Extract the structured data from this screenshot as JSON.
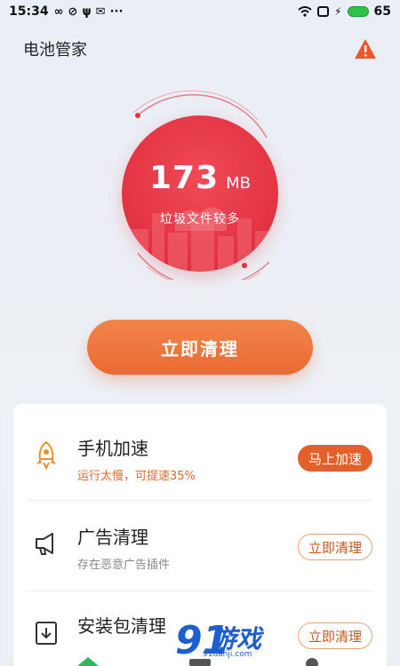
{
  "status_bar": {
    "time": "15:34",
    "left_icons": [
      "infinity-icon",
      "circle-check-icon",
      "usb-icon",
      "mail-icon",
      "more-dots-icon"
    ],
    "battery": "65",
    "right_icons": [
      "wifi-icon",
      "screen-icon",
      "charging-icon",
      "battery-icon"
    ]
  },
  "header": {
    "title": "电池管家",
    "warning_icon": "warning-triangle-icon"
  },
  "gauge": {
    "value": "173",
    "unit": "MB",
    "subtitle": "垃圾文件较多"
  },
  "primary_action": {
    "label": "立即清理"
  },
  "features": [
    {
      "icon": "rocket-icon",
      "title": "手机加速",
      "subtitle": "运行太慢，可提速35%",
      "button": "马上加速",
      "highlight": true
    },
    {
      "icon": "megaphone-icon",
      "title": "广告清理",
      "subtitle": "存在恶意广告插件",
      "button": "立即清理",
      "highlight": false
    },
    {
      "icon": "package-icon",
      "title": "安装包清理",
      "subtitle": "",
      "button": "立即清理",
      "highlight": false
    }
  ],
  "watermark": {
    "text": "游戏",
    "small": "91danji.com"
  },
  "colors": {
    "accent_orange": "#e2612a",
    "gauge_red": "#e23242",
    "warning_orange": "#e8582a",
    "nav_active": "#2eb85c"
  }
}
